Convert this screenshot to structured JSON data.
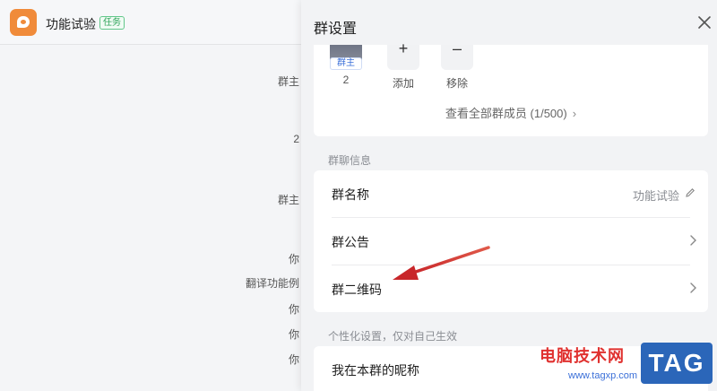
{
  "chat": {
    "title": "功能试验",
    "tag": "任务",
    "lines": [
      "群主",
      "2",
      "群主",
      "你",
      "翻译功能例",
      "你",
      "你",
      "你"
    ]
  },
  "panel": {
    "title": "群设置",
    "members": {
      "owner_tag": "群主",
      "owner_count": "2",
      "add_label": "添加",
      "remove_label": "移除",
      "view_all": "查看全部群成员 (1/500)"
    },
    "info_section": "群聊信息",
    "rows": {
      "name_label": "群名称",
      "name_value": "功能试验",
      "notice_label": "群公告",
      "qr_label": "群二维码"
    },
    "personal_section": "个性化设置，仅对自己生效",
    "nickname_label": "我在本群的昵称"
  },
  "watermark": {
    "text": "电脑技术网",
    "url": "www.tagxp.com",
    "tag": "TAG"
  },
  "colors": {
    "accent_arrow": "#d83a3a",
    "tag_green": "#2fa35a",
    "owner_blue": "#3a6fd8"
  }
}
